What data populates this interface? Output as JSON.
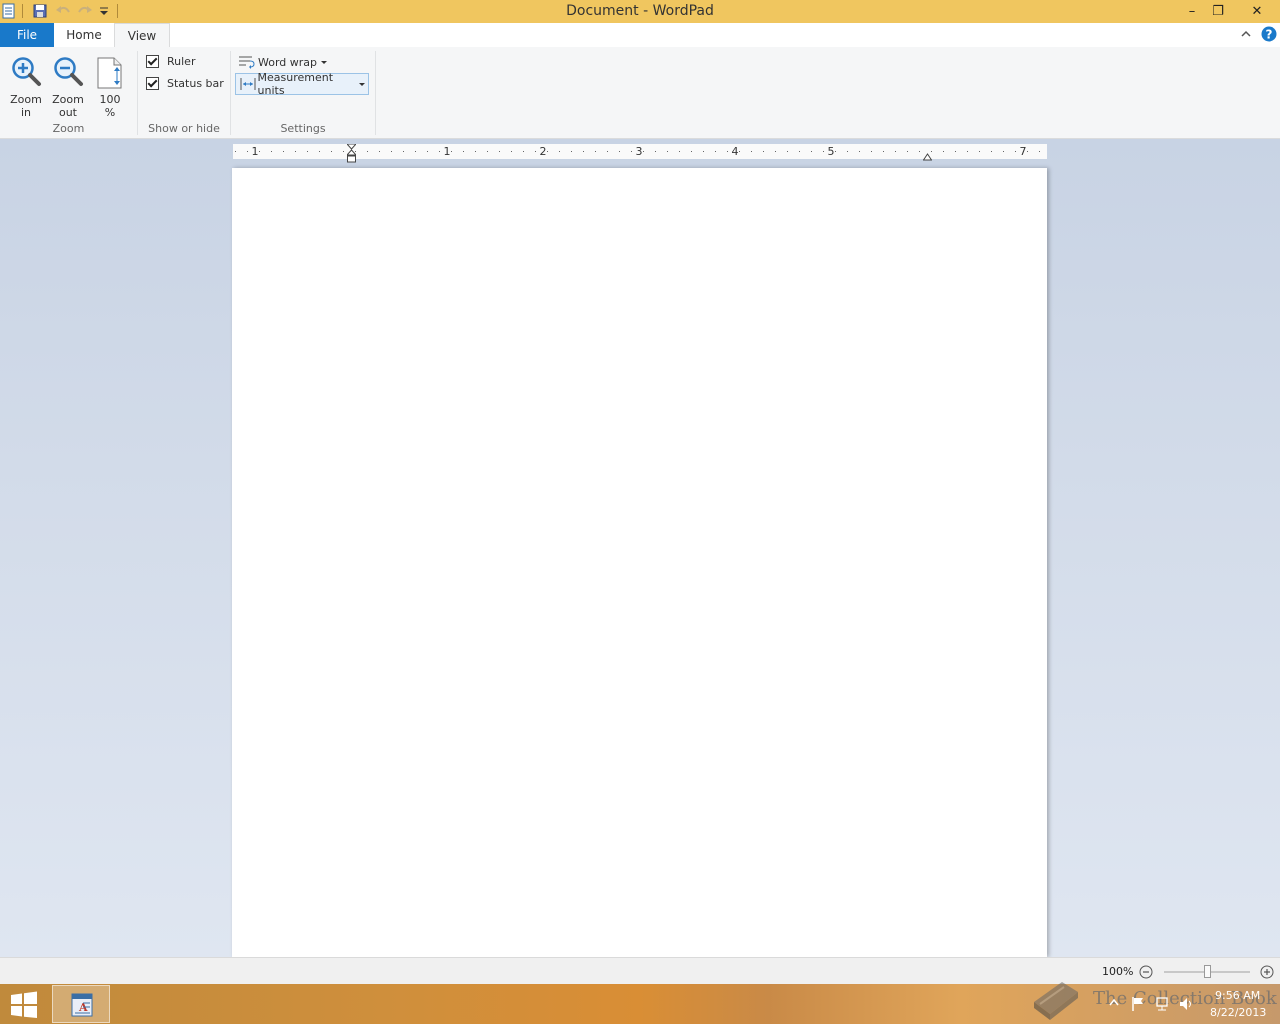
{
  "window": {
    "title": "Document - WordPad",
    "controls": {
      "minimize": "–",
      "restore": "❐",
      "close": "✕"
    }
  },
  "ribbon_tabs": {
    "file": "File",
    "home": "Home",
    "view": "View"
  },
  "zoom_group": {
    "label": "Zoom",
    "zoom_in_line1": "Zoom",
    "zoom_in_line2": "in",
    "zoom_out_line1": "Zoom",
    "zoom_out_line2": "out",
    "hundred_line1": "100",
    "hundred_line2": "%"
  },
  "show_hide_group": {
    "label": "Show or hide",
    "ruler": "Ruler",
    "status_bar": "Status bar",
    "ruler_checked": true,
    "status_bar_checked": true
  },
  "settings_group": {
    "label": "Settings",
    "word_wrap": "Word wrap",
    "measurement_units": "Measurement units"
  },
  "ruler": {
    "numbers": [
      "1",
      "1",
      "2",
      "3",
      "4",
      "5",
      "7"
    ]
  },
  "status": {
    "zoom_level": "100%",
    "zoom_slider_fraction": 0.5
  },
  "taskbar": {
    "watermark": "The Collection Book",
    "time": "9:56 AM",
    "date": "8/22/2013"
  },
  "colors": {
    "titlebar": "#f0c65f",
    "file_tab": "#1979ca",
    "help": "#1979ca"
  }
}
